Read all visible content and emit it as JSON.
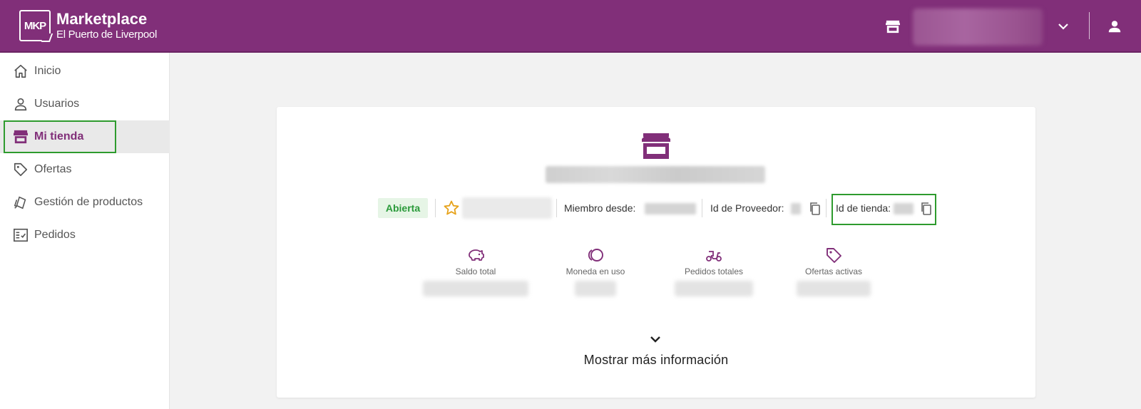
{
  "header": {
    "logo_mark": "MKP",
    "title": "Marketplace",
    "subtitle": "El Puerto de Liverpool",
    "icons": [
      "store-icon",
      "chevron-down-icon",
      "user-icon"
    ],
    "background_color": "#812f79"
  },
  "sidebar": {
    "items": [
      {
        "label": "Inicio",
        "icon": "home-icon",
        "active": false
      },
      {
        "label": "Usuarios",
        "icon": "user-icon",
        "active": false
      },
      {
        "label": "Mi tienda",
        "icon": "store-icon",
        "active": true
      },
      {
        "label": "Ofertas",
        "icon": "tag-icon",
        "active": false
      },
      {
        "label": "Gestión de productos",
        "icon": "products-icon",
        "active": false
      },
      {
        "label": "Pedidos",
        "icon": "checklist-icon",
        "active": false
      }
    ]
  },
  "store_card": {
    "status": "Abierta",
    "member_since_label": "Miembro desde:",
    "provider_id_label": "Id de Proveedor:",
    "store_id_label": "Id de tienda:",
    "stats": [
      {
        "label": "Saldo total",
        "icon": "piggy-bank-icon"
      },
      {
        "label": "Moneda en uso",
        "icon": "coins-icon"
      },
      {
        "label": "Pedidos totales",
        "icon": "delivery-scooter-icon"
      },
      {
        "label": "Ofertas activas",
        "icon": "tag-icon"
      }
    ],
    "more_info": "Mostrar más información",
    "accent_color": "#812f79",
    "status_color": "#2a9a3a"
  }
}
